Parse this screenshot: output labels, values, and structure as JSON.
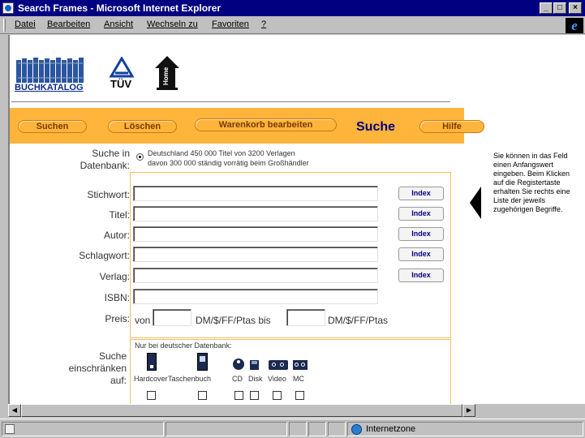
{
  "window": {
    "title": "Search Frames - Microsoft Internet Explorer",
    "controls": [
      "_",
      "□",
      "×"
    ]
  },
  "menu": [
    "Datei",
    "Bearbeiten",
    "Ansicht",
    "Wechseln zu",
    "Favoriten",
    "?"
  ],
  "logos": {
    "buchkatalog": "BUCHKATALOG",
    "tuev": "TÜV",
    "home": "Home"
  },
  "navbar": {
    "suchen": "Suchen",
    "loeschen": "Löschen",
    "warenkorb": "Warenkorb bearbeiten",
    "title": "Suche",
    "hilfe": "Hilfe"
  },
  "database": {
    "label": "Suche in Datenbank:",
    "option_line1": "Deutschland 450 000 Titel von 3200 Verlagen",
    "option_line2": "davon 300 000 ständig vorrätig beim Großhändler"
  },
  "fields": [
    {
      "label": "Stichwort:",
      "has_index": true
    },
    {
      "label": "Titel:",
      "has_index": true
    },
    {
      "label": "Autor:",
      "has_index": true
    },
    {
      "label": "Schlagwort:",
      "has_index": true
    },
    {
      "label": "Verlag:",
      "has_index": true
    },
    {
      "label": "ISBN:",
      "has_index": false
    }
  ],
  "index_label": "Index",
  "price": {
    "label": "Preis:",
    "von": "von",
    "currency1": "DM/$/FF/Ptas bis",
    "currency2": "DM/$/FF/Ptas"
  },
  "restrict": {
    "label": "Suche einschränken auf:",
    "note": "Nur bei deutscher Datenbank:",
    "options": [
      "Hardcover",
      "Taschenbuch",
      "CD",
      "Disk",
      "Video",
      "MC"
    ]
  },
  "help_text": "Sie können in das Feld einen Anfangswert eingeben. Beim Klicken auf die Registertaste erhalten Sie rechts eine Liste der jeweils zugehörigen Begriffe.",
  "status": {
    "zone": "Internetzone"
  }
}
